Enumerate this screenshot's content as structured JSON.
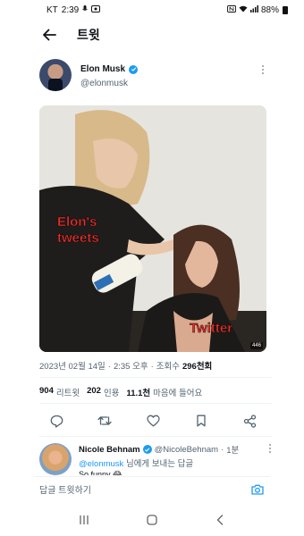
{
  "status_bar": {
    "carrier": "KT",
    "time": "2:39",
    "battery": "88%"
  },
  "header": {
    "title": "트윗",
    "back_icon": "arrow-left-icon"
  },
  "tweet": {
    "author": {
      "name": "Elon Musk",
      "handle": "@elonmusk",
      "verified": true
    },
    "media": {
      "label_top": "Elon's tweets",
      "label_top_line1": "Elon's",
      "label_top_line2": "tweets",
      "label_bottom": "Twitter",
      "gif_badge": "446"
    },
    "timestamp": {
      "date": "2023년 02월 14일",
      "sep1": "·",
      "time": "2:35 오후",
      "sep2": "·",
      "views_label": "조회수",
      "views_value": "296천회"
    },
    "stats": {
      "retweets_value": "904",
      "retweets_label": "리트윗",
      "quotes_value": "202",
      "quotes_label": "인용",
      "likes_value": "11.1천",
      "likes_label": "마음에 들어요"
    },
    "actions": [
      "reply-icon",
      "retweet-icon",
      "like-icon",
      "bookmark-icon",
      "share-icon"
    ]
  },
  "reply": {
    "name": "Nicole Behnam",
    "handle": "@NicoleBehnam",
    "sep": "·",
    "time": "1분",
    "mention": "@elonmusk",
    "context": "님에게 보내는 답글",
    "cut_text": "So funny 😂"
  },
  "composer": {
    "placeholder": "답글 트윗하기"
  },
  "colors": {
    "accent": "#1d9bf0",
    "text_primary": "#0f1419",
    "text_secondary": "#536471",
    "label_red": "#e8302a"
  }
}
